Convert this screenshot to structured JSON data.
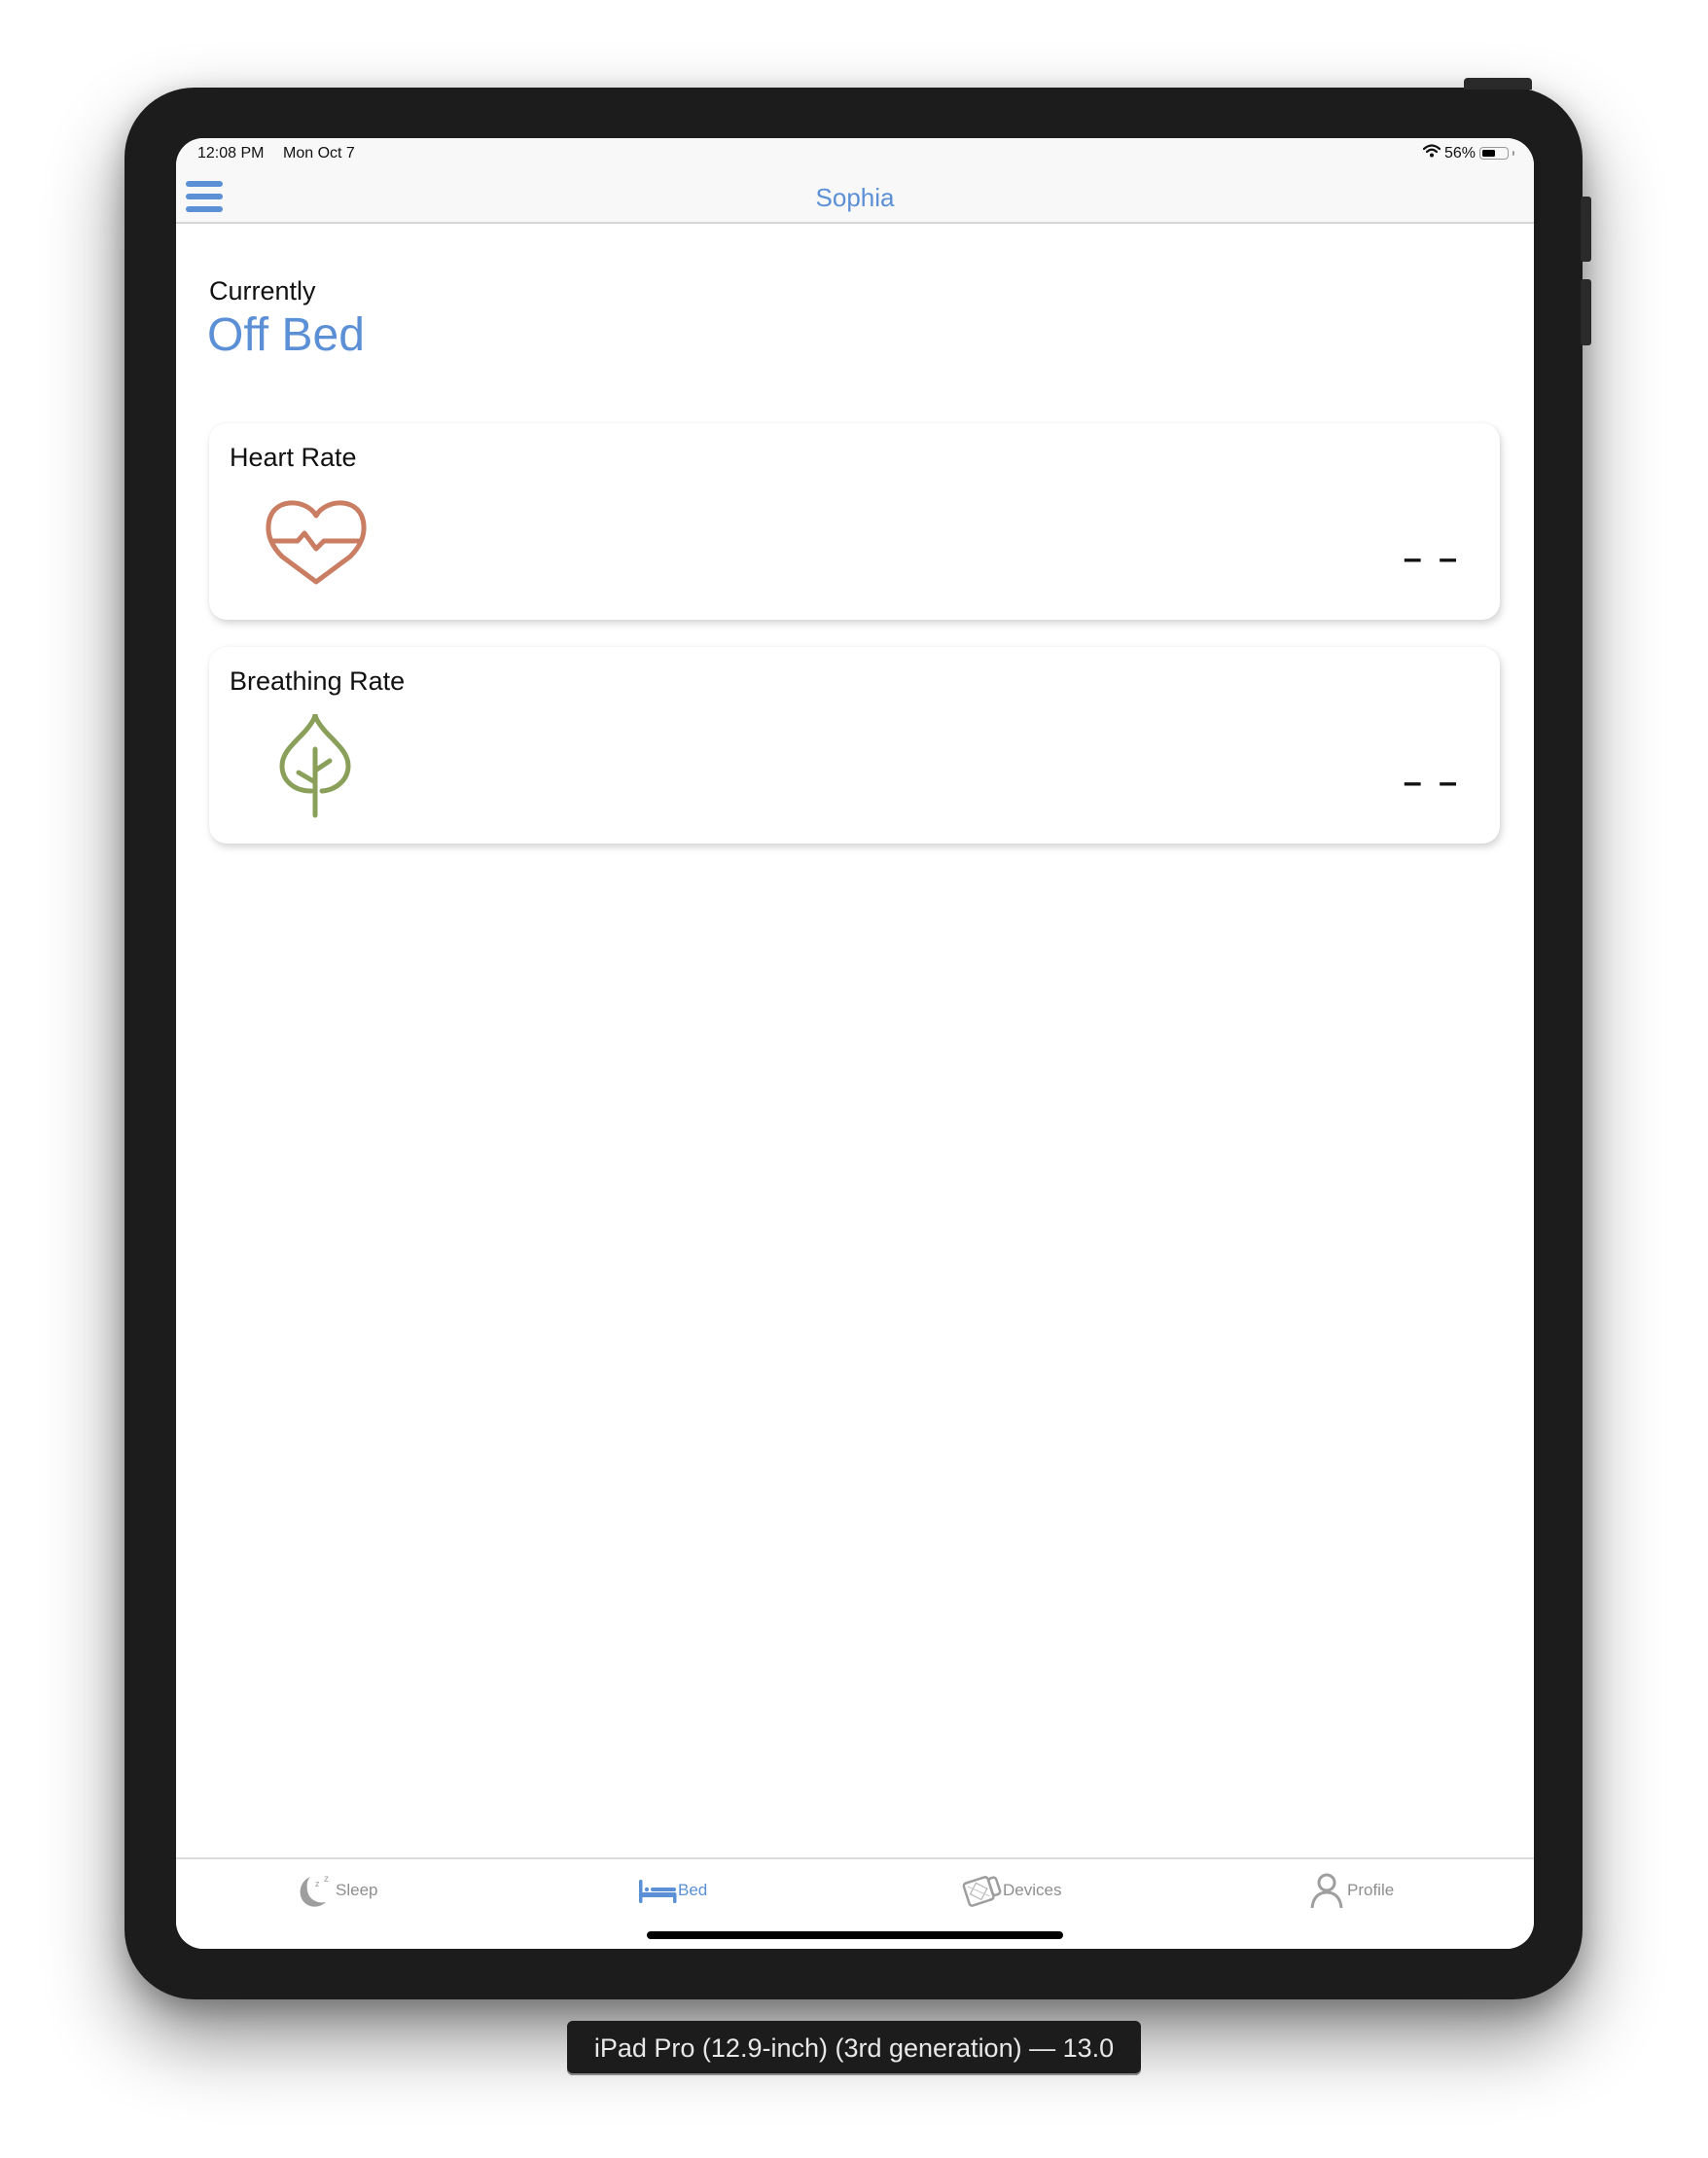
{
  "status_bar": {
    "time": "12:08 PM",
    "date": "Mon Oct 7",
    "battery_percent": "56%",
    "battery_level": 0.56,
    "wifi_icon": "wifi-icon"
  },
  "nav": {
    "title": "Sophia",
    "menu_icon": "hamburger-menu-icon"
  },
  "bed_status": {
    "label": "Currently",
    "value": "Off Bed"
  },
  "cards": [
    {
      "title": "Heart Rate",
      "icon": "heart-pulse-icon",
      "value": "– –",
      "icon_color": "#c97d62"
    },
    {
      "title": "Breathing Rate",
      "icon": "leaf-icon",
      "value": "– –",
      "icon_color": "#8a9f5a"
    }
  ],
  "tabs": [
    {
      "label": "Sleep",
      "icon": "moon-sleep-icon",
      "active": false
    },
    {
      "label": "Bed",
      "icon": "bed-icon",
      "active": true
    },
    {
      "label": "Devices",
      "icon": "devices-icon",
      "active": false
    },
    {
      "label": "Profile",
      "icon": "person-icon",
      "active": false
    }
  ],
  "device_label": "iPad Pro (12.9-inch) (3rd generation) — 13.0",
  "colors": {
    "accent": "#5b8fd6",
    "inactive_tab": "#8e8e8e",
    "device_frame": "#1c1c1c"
  }
}
